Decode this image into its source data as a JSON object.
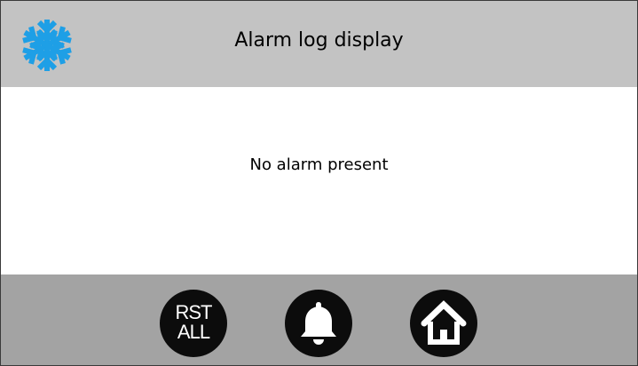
{
  "header": {
    "title": "Alarm log display",
    "logo_icon": "snowflake-icon",
    "logo_color": "#1e9fe6"
  },
  "content": {
    "message": "No alarm present"
  },
  "footer": {
    "reset_all": {
      "line1": "RST",
      "line2": "ALL"
    },
    "alarm_icon": "bell-icon",
    "home_icon": "home-icon"
  },
  "colors": {
    "header_bg": "#c3c3c3",
    "footer_bg": "#a3a3a3",
    "button_bg": "#0c0c0c"
  }
}
